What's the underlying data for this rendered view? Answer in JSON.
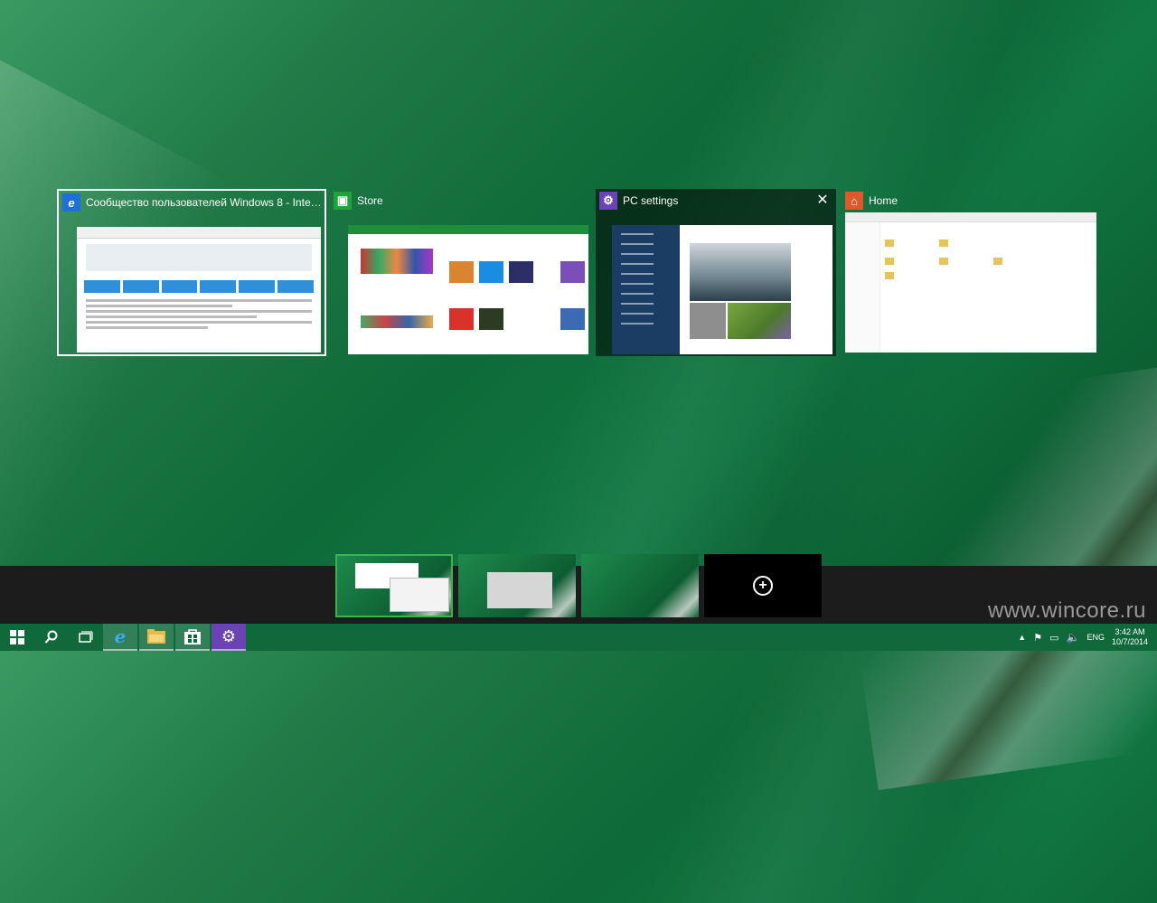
{
  "windows": [
    {
      "title": "Сообщество пользователей Windows 8 - Internet Ex...",
      "icon": "internet-explorer-icon"
    },
    {
      "title": "Store",
      "icon": "store-icon"
    },
    {
      "title": "PC settings",
      "icon": "gear-icon",
      "close": "✕"
    },
    {
      "title": "Home",
      "icon": "home-icon"
    }
  ],
  "desktops": {
    "count": 4,
    "active": 1,
    "add_label": "+"
  },
  "taskbar": {
    "start": "start-icon",
    "search": "search-icon",
    "task_view": "task-view-icon",
    "pinned": [
      "internet-explorer-icon",
      "file-explorer-icon",
      "store-icon",
      "gear-icon"
    ]
  },
  "tray": {
    "lang": "ENG",
    "time": "3:42 AM",
    "date": "10/7/2014"
  },
  "watermark": "www.wincore.ru",
  "colors": {
    "accent": "#10693a",
    "ie_blue": "#1e6fd9",
    "store_green": "#22a33b",
    "settings_purple": "#6b43b5",
    "home_orange": "#e0592a"
  }
}
